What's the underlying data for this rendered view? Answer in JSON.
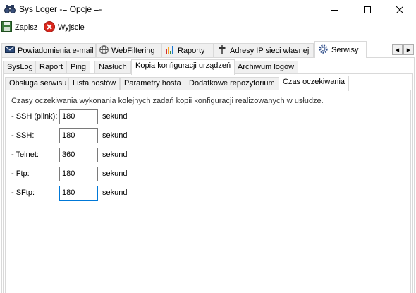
{
  "window": {
    "title": "Sys Loger -= Opcje =-"
  },
  "toolbar": {
    "save_label": "Zapisz",
    "exit_label": "Wyjście"
  },
  "main_tabs": [
    {
      "label": "Powiadomienia e-mail",
      "icon": "email-icon"
    },
    {
      "label": "WebFiltering",
      "icon": "globe-icon"
    },
    {
      "label": "Raporty",
      "icon": "chart-icon"
    },
    {
      "label": "Adresy IP sieci własnej",
      "icon": "signpost-icon"
    },
    {
      "label": "Serwisy",
      "icon": "gear-icon",
      "active": true
    }
  ],
  "sub_tabs": [
    {
      "label": "SysLog"
    },
    {
      "label": "Raport"
    },
    {
      "label": "Ping"
    },
    {
      "label": "Nasłuch"
    },
    {
      "label": "Kopia konfiguracji urządzeń",
      "active": true
    },
    {
      "label": "Archiwum logów"
    }
  ],
  "inner_tabs": [
    {
      "label": "Obsługa serwisu"
    },
    {
      "label": "Lista hostów"
    },
    {
      "label": "Parametry hosta"
    },
    {
      "label": "Dodatkowe repozytorium"
    },
    {
      "label": "Czas oczekiwania",
      "active": true
    }
  ],
  "timeout": {
    "description": "Czasy oczekiwania wykonania kolejnych zadań kopii konfiguracji realizowanych w usłudze.",
    "rows": [
      {
        "label": "- SSH (plink):",
        "value": "180",
        "unit": "sekund"
      },
      {
        "label": "- SSH:",
        "value": "180",
        "unit": "sekund"
      },
      {
        "label": "- Telnet:",
        "value": "360",
        "unit": "sekund"
      },
      {
        "label": "- Ftp:",
        "value": "180",
        "unit": "sekund"
      },
      {
        "label": "- SFtp:",
        "value": "180",
        "unit": "sekund",
        "focused": true
      }
    ]
  },
  "colors": {
    "accent": "#0078d7",
    "tab_bg": "#f0f0f0",
    "border": "#d9d9d9"
  }
}
